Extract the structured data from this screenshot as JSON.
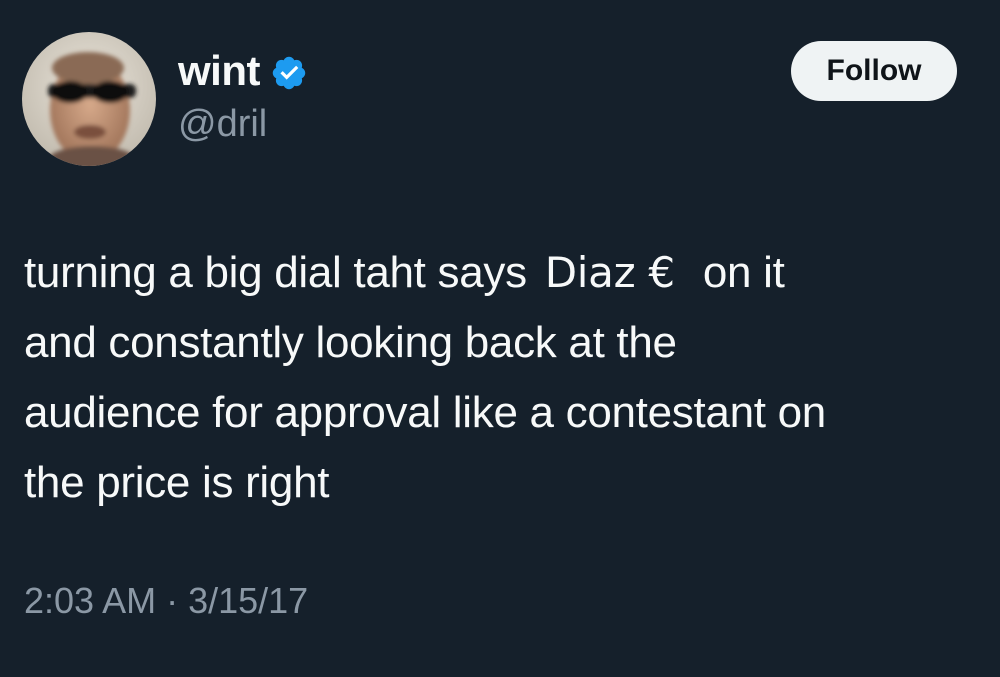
{
  "author": {
    "display_name": "wint",
    "handle": "@dril",
    "verified": true,
    "avatar_icon": "user-avatar"
  },
  "follow_button": {
    "label": "Follow"
  },
  "tweet": {
    "line1_before": "turning a big dial taht says",
    "line1_mark": "Diaz €",
    "line1_after": "on it",
    "line2": "and constantly looking back at the",
    "line3": "audience for approval like a contestant on",
    "line4": "the price is right"
  },
  "timestamp": "2:03 AM · 3/15/17",
  "colors": {
    "background": "#15202b",
    "verified_badge": "#1d9bf0",
    "secondary_text": "#8b98a5",
    "button_bg": "#eff3f4"
  }
}
